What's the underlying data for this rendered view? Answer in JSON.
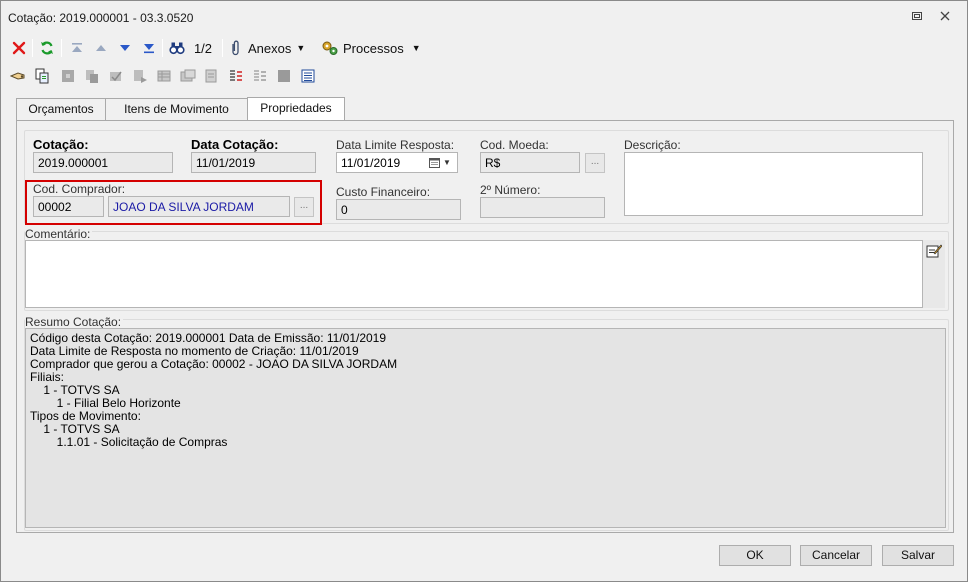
{
  "window": {
    "title": "Cotação: 2019.000001 - 03.3.0520",
    "restore_icon": "restore-icon",
    "close_icon": "close-icon"
  },
  "toolbar": {
    "record_position": "1/2",
    "attachments_label": "Anexos",
    "processes_label": "Processos"
  },
  "tabs": [
    {
      "label": "Orçamentos"
    },
    {
      "label": "Itens de Movimento"
    },
    {
      "label": "Propriedades"
    }
  ],
  "form": {
    "cotacao_label": "Cotação:",
    "cotacao_value": "2019.000001",
    "data_cotacao_label": "Data Cotação:",
    "data_cotacao_value": "11/01/2019",
    "data_limite_label": "Data Limite Resposta:",
    "data_limite_value": "11/01/2019",
    "cod_moeda_label": "Cod. Moeda:",
    "cod_moeda_value": "R$",
    "descricao_label": "Descrição:",
    "cod_comprador_label": "Cod. Comprador:",
    "cod_comprador_value": "00002",
    "comprador_name": "JOAO DA SILVA JORDAM",
    "custo_financeiro_label": "Custo Financeiro:",
    "custo_financeiro_value": "0",
    "segundo_numero_label": "2º Número:",
    "segundo_numero_value": "",
    "comentario_label": "Comentário:",
    "resumo_label": "Resumo Cotação:"
  },
  "resumo_lines": [
    "Código desta Cotação: 2019.000001 Data de Emissão: 11/01/2019",
    "Data Limite de Resposta no momento de Criação: 11/01/2019",
    "Comprador que gerou a Cotação: 00002 - JOAO DA SILVA JORDAM",
    "Filiais:",
    "    1 - TOTVS SA",
    "        1 - Filial Belo Horizonte",
    "Tipos de Movimento:",
    "    1 - TOTVS SA",
    "        1.1.01 - Solicitação de Compras"
  ],
  "buttons": {
    "ok": "OK",
    "cancel": "Cancelar",
    "save": "Salvar"
  },
  "colors": {
    "highlight": "#d40000",
    "link_text": "#1a1aa6"
  }
}
